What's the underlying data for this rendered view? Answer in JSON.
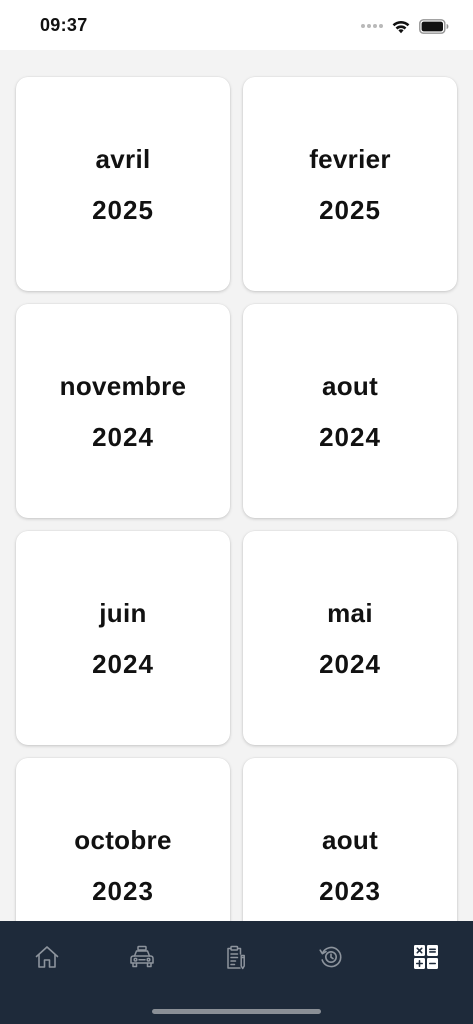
{
  "status_bar": {
    "time": "09:37",
    "icons": [
      "signal-dots-icon",
      "wifi-icon",
      "battery-icon"
    ]
  },
  "cards": [
    {
      "month": "avril",
      "year": "2025"
    },
    {
      "month": "fevrier",
      "year": "2025"
    },
    {
      "month": "novembre",
      "year": "2024"
    },
    {
      "month": "aout",
      "year": "2024"
    },
    {
      "month": "juin",
      "year": "2024"
    },
    {
      "month": "mai",
      "year": "2024"
    },
    {
      "month": "octobre",
      "year": "2023"
    },
    {
      "month": "aout",
      "year": "2023"
    }
  ],
  "tab_bar": {
    "tabs": [
      {
        "icon": "home-icon",
        "active": false
      },
      {
        "icon": "taxi-icon",
        "active": false
      },
      {
        "icon": "clipboard-pencil-icon",
        "active": false
      },
      {
        "icon": "history-clock-icon",
        "active": false
      },
      {
        "icon": "calculator-icon",
        "active": true
      }
    ]
  },
  "colors": {
    "background": "#f3f3f3",
    "card": "#ffffff",
    "tab_bar": "#1e2a3a",
    "tab_icon_inactive": "#8d949d",
    "tab_icon_active": "#ffffff"
  }
}
